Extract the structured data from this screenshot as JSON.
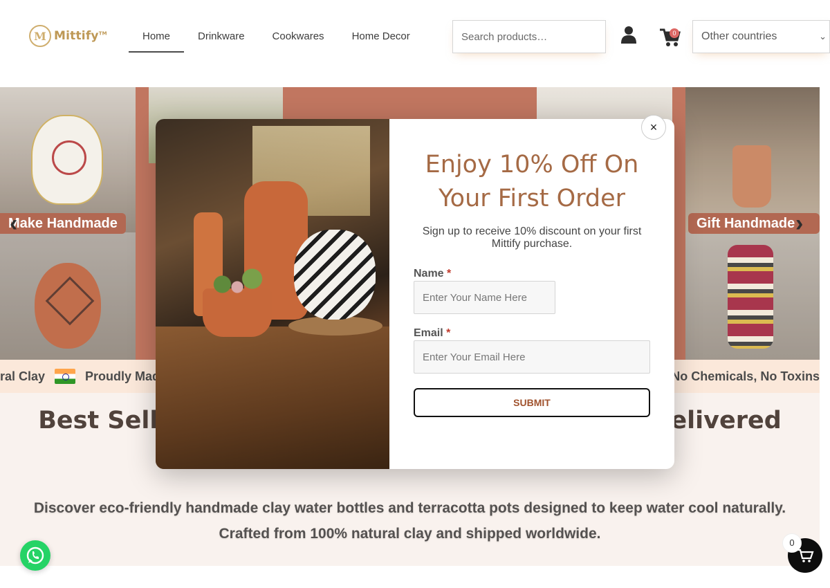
{
  "brand": {
    "name": "Mittify",
    "tm": "TM",
    "mark": "M"
  },
  "nav": {
    "items": [
      {
        "label": "Home"
      },
      {
        "label": "Drinkware"
      },
      {
        "label": "Cookwares"
      },
      {
        "label": "Home Decor"
      }
    ]
  },
  "search": {
    "placeholder": "Search products…",
    "value": ""
  },
  "cart": {
    "count": "0"
  },
  "country_select": {
    "selected": "Other countries"
  },
  "banner": {
    "label_left": "Make Handmade",
    "label_right": "Gift Handmade",
    "prev_arrow": "‹",
    "next_arrow": "›"
  },
  "marquee": {
    "left_text_1": "ral Clay",
    "left_text_2": "Proudly Mad",
    "right_text": "No Chemicals, No Toxins"
  },
  "section": {
    "heading_left": "Best Selli",
    "heading_right": "Delivered",
    "description_line1": "Discover eco-friendly handmade clay water bottles and terracotta pots designed to keep water cool naturally.",
    "description_line2": "Crafted from 100% natural clay and shipped worldwide."
  },
  "popup": {
    "title_line1": "Enjoy 10% Off On",
    "title_line2": "Your First Order",
    "subtitle_line1": "Sign up to receive 10% discount on your first",
    "subtitle_line2": "Mittify purchase.",
    "name_label": "Name",
    "name_placeholder": "Enter Your Name Here",
    "email_label": "Email",
    "email_placeholder": "Enter Your Email Here",
    "required_mark": "*",
    "submit_label": "SUBMIT",
    "close_label": "×"
  },
  "floating_cart": {
    "count": "0"
  },
  "colors": {
    "brand_gold": "#b58a3e",
    "terracotta": "#b9644a",
    "popup_title": "#a56a45",
    "whatsapp": "#25d366"
  },
  "icons": [
    "user-icon",
    "cart-icon",
    "chevron-down-icon",
    "close-icon",
    "whatsapp-icon",
    "cart-icon-floating",
    "india-flag-icon"
  ]
}
